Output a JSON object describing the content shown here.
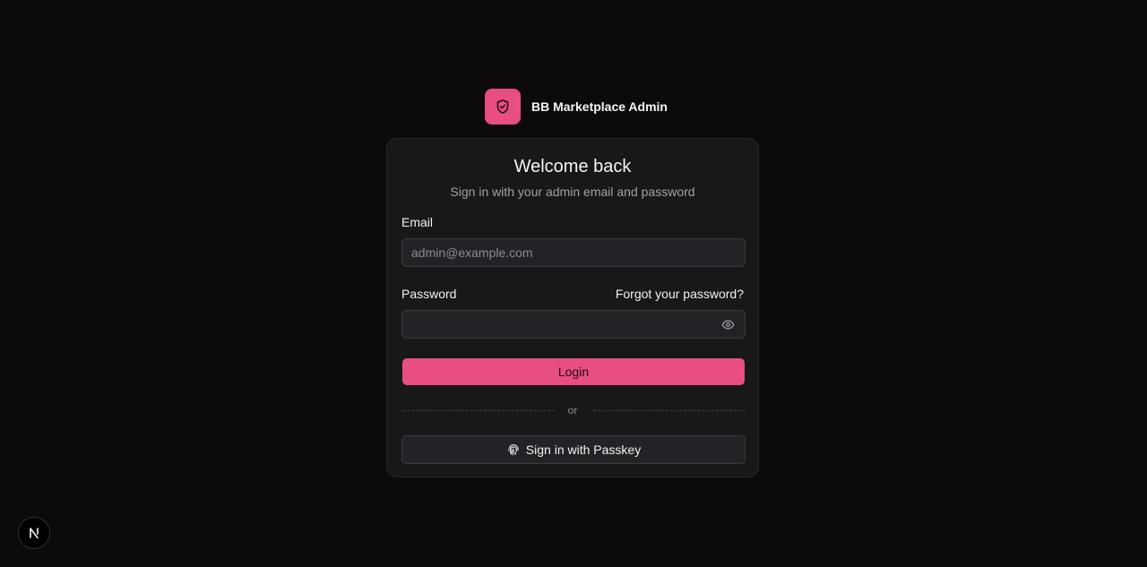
{
  "brand": {
    "name": "BB Marketplace Admin",
    "logo_icon": "shield-check-icon",
    "accent_color": "#e84d84"
  },
  "card": {
    "title": "Welcome back",
    "subtitle": "Sign in with your admin email and password"
  },
  "form": {
    "email_label": "Email",
    "email_placeholder": "admin@example.com",
    "email_value": "",
    "password_label": "Password",
    "password_value": "",
    "forgot_link": "Forgot your password?",
    "show_password_icon": "eye-icon",
    "login_label": "Login",
    "divider_text": "or",
    "passkey_label": "Sign in with Passkey",
    "passkey_icon": "fingerprint-icon"
  },
  "dev_badge": {
    "letter": "N",
    "icon": "nextjs-icon"
  }
}
